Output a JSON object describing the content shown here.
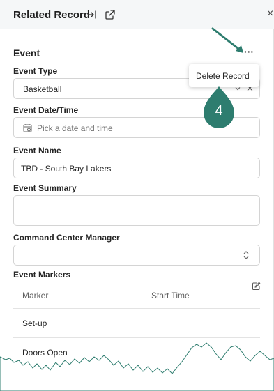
{
  "header": {
    "title": "Related Record",
    "icons": [
      "move-to-side-icon",
      "open-external-icon",
      "close-icon"
    ],
    "close_glyph": "×"
  },
  "section": {
    "title": "Event",
    "more_glyph": "···"
  },
  "context_menu": {
    "items": [
      "Delete Record"
    ]
  },
  "callout": {
    "number": "4",
    "color": "#2e7d6f"
  },
  "fields": {
    "event_type": {
      "label": "Event Type",
      "value": "Basketball"
    },
    "event_datetime": {
      "label": "Event Date/Time",
      "placeholder": "Pick a date and time"
    },
    "event_name": {
      "label": "Event Name",
      "value": "TBD - South Bay Lakers"
    },
    "event_summary": {
      "label": "Event Summary",
      "value": ""
    },
    "command_center_manager": {
      "label": "Command Center Manager",
      "value": ""
    }
  },
  "markers": {
    "label": "Event Markers",
    "columns": [
      "Marker",
      "Start Time"
    ],
    "rows": [
      {
        "marker": "Set-up",
        "start_time": ""
      },
      {
        "marker": "Doors Open",
        "start_time": ""
      }
    ]
  },
  "colors": {
    "accent": "#2e7d6f",
    "header_bg": "#f5f7f8",
    "border": "#d4d4d4"
  }
}
